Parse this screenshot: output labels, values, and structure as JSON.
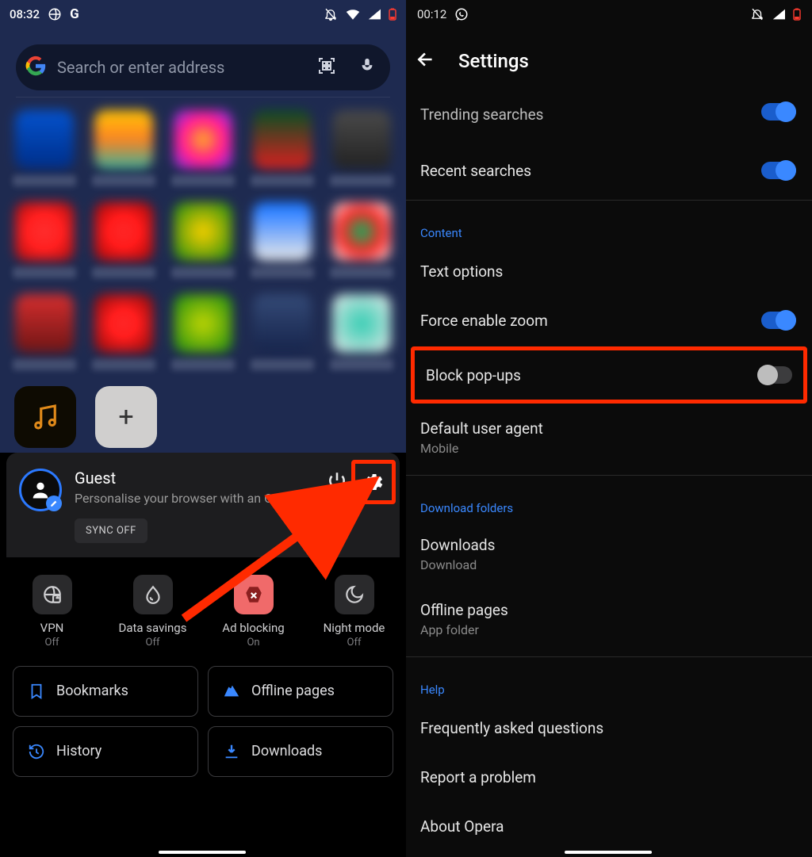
{
  "left": {
    "status": {
      "time": "08:32"
    },
    "search": {
      "placeholder": "Search or enter address"
    },
    "account": {
      "name": "Guest",
      "subtitle": "Personalise your browser with an Opera account",
      "sync_chip": "SYNC OFF"
    },
    "quick": [
      {
        "label": "VPN",
        "state": "Off"
      },
      {
        "label": "Data savings",
        "state": "Off"
      },
      {
        "label": "Ad blocking",
        "state": "On"
      },
      {
        "label": "Night mode",
        "state": "Off"
      }
    ],
    "nav": {
      "bookmarks": "Bookmarks",
      "offline": "Offline pages",
      "history": "History",
      "downloads": "Downloads"
    }
  },
  "right": {
    "status": {
      "time": "00:12"
    },
    "title": "Settings",
    "rows": {
      "trending": "Trending searches",
      "recent": "Recent searches",
      "content_hdr": "Content",
      "text_opts": "Text options",
      "force_zoom": "Force enable zoom",
      "block_pop": "Block pop-ups",
      "ua_title": "Default user agent",
      "ua_value": "Mobile",
      "dl_hdr": "Download folders",
      "dl_title": "Downloads",
      "dl_value": "Download",
      "off_title": "Offline pages",
      "off_value": "App folder",
      "help_hdr": "Help",
      "faq": "Frequently asked questions",
      "report": "Report a problem",
      "about": "About Opera"
    }
  }
}
